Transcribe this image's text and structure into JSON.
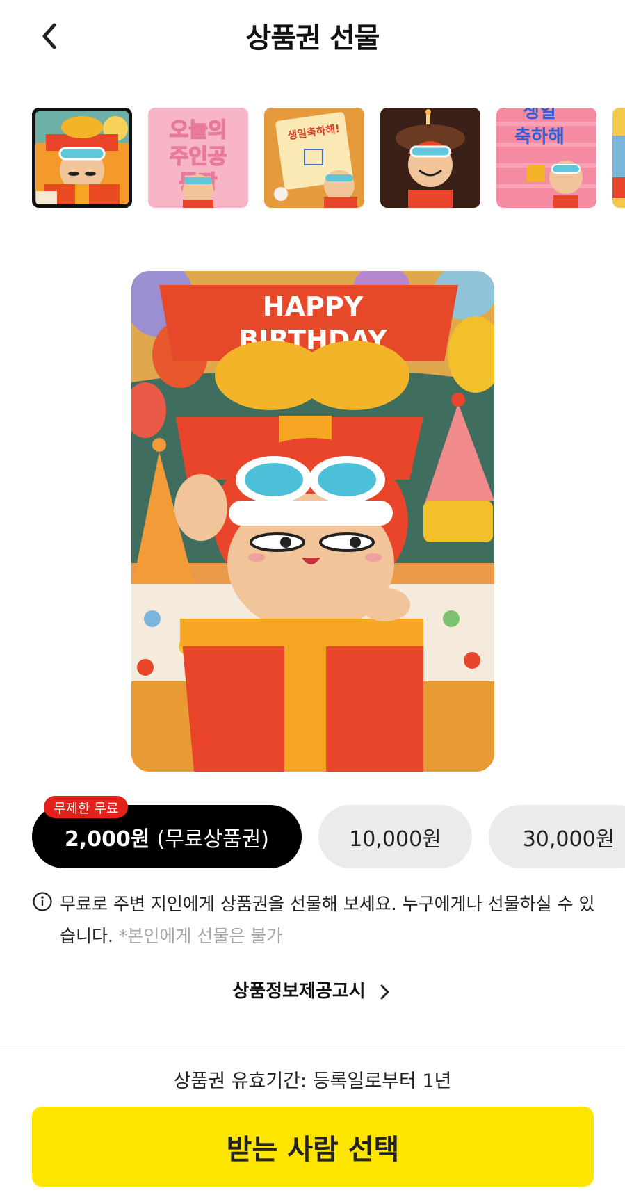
{
  "header": {
    "title": "상품권 선물",
    "back_icon": "chevron-left-icon"
  },
  "thumbnails": [
    {
      "name": "gift-box-thumb",
      "selected": true
    },
    {
      "name": "oneului-juingong-thumb",
      "selected": false,
      "text": "오늘의 주인공 등장"
    },
    {
      "name": "birthday-card-thumb",
      "selected": false,
      "text": "생일축하해!"
    },
    {
      "name": "birthday-cake-thumb",
      "selected": false
    },
    {
      "name": "saengil-chukhahae-thumb",
      "selected": false,
      "text": "생일 축하해"
    },
    {
      "name": "partial-thumb",
      "selected": false
    }
  ],
  "main_image": {
    "banner_text": "HAPPY BIRTHDAY"
  },
  "amounts": {
    "badge": "무제한 무료",
    "selected_amount": "2,000원",
    "selected_suffix": "(무료상품권)",
    "options": [
      "10,000원",
      "30,000원"
    ]
  },
  "info": {
    "text": "무료로 주변 지인에게 상품권을 선물해 보세요. 누구에게나 선물하실 수 있습니다.",
    "note": "*본인에게 선물은 불가"
  },
  "notice_link": "상품정보제공고시",
  "validity": "상품권 유효기간: 등록일로부터 1년",
  "cta_label": "받는 사람 선택",
  "colors": {
    "accent_yellow": "#fee500",
    "badge_red": "#e4201b",
    "selected_black": "#000000"
  }
}
